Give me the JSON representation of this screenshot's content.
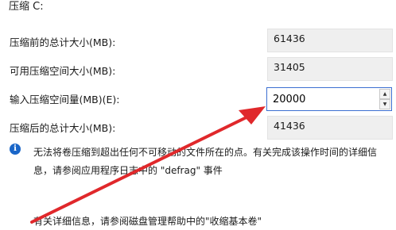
{
  "window": {
    "title": "压缩 C:"
  },
  "rows": [
    {
      "label": "压缩前的总计大小(MB):",
      "value": "61436"
    },
    {
      "label": "可用压缩空间大小(MB):",
      "value": "31405"
    },
    {
      "label": "输入压缩空间量(MB)(E):",
      "value": "20000"
    },
    {
      "label": "压缩后的总计大小(MB):",
      "value": "41436"
    }
  ],
  "info": {
    "icon": "info-icon",
    "glyph": "i",
    "text": "无法将卷压缩到超出任何不可移动的文件所在的点。有关完成该操作时间的详细信息，请参阅应用程序日志中的 \"defrag\" 事件"
  },
  "footer": {
    "text": "有关详细信息，请参阅磁盘管理帮助中的\"收缩基本卷\""
  },
  "spinner": {
    "up_glyph": "▲",
    "down_glyph": "▼"
  },
  "colors": {
    "arrow": "#e0282b",
    "input_border": "#3c6fd1",
    "info_icon": "#1a66c8"
  }
}
